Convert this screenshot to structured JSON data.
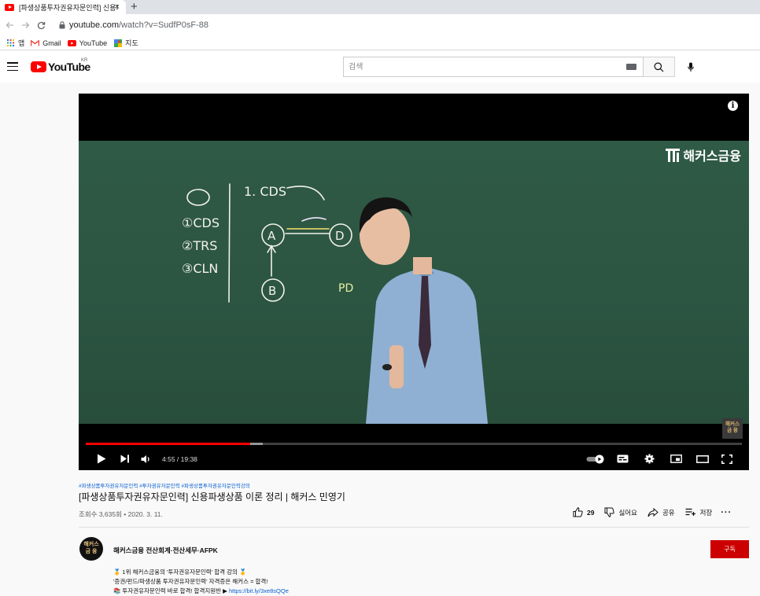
{
  "browser": {
    "tab_title": "[파생상품투자권유자문인력] 신용파생",
    "tab_close": "×",
    "new_tab": "+",
    "url_host": "youtube.com",
    "url_path": "/watch?v=SudfP0sF-88",
    "bookmarks": [
      {
        "label": "앱",
        "icon": "apps-grid-icon"
      },
      {
        "label": "Gmail",
        "icon": "gmail-icon"
      },
      {
        "label": "YouTube",
        "icon": "youtube-icon"
      },
      {
        "label": "지도",
        "icon": "maps-icon"
      }
    ]
  },
  "header": {
    "logo_text": "YouTube",
    "region": "KR",
    "search_placeholder": "검색"
  },
  "player": {
    "brand": "해커스금융",
    "watermark_line1": "해커스",
    "watermark_line2": "금 융",
    "current_time": "4:55",
    "duration": "19:38",
    "time_display": "4:55 / 19:38",
    "progress_played": 0.25,
    "progress_loaded": 0.27,
    "chalk_lines": [
      "1. CDS",
      "①CDS",
      "②TRS",
      "③CLN",
      "A",
      "B",
      "D",
      "PD"
    ]
  },
  "video": {
    "hashtags": "#파생상품투자권유자문인력 #투자권유자문인력 #파생상품투자권유자문인력강의",
    "title": "[파생상품투자권유자문인력] 신용파생상품 이론 정리 | 해커스 민영기",
    "meta": "조회수 3,635회 • 2020. 3. 11.",
    "likes": "29",
    "dislike_label": "싫어요",
    "share_label": "공유",
    "save_label": "저장",
    "more_label": "···"
  },
  "channel": {
    "avatar_line1": "해커스",
    "avatar_line2": "금 융",
    "name": "해커스금융 전산회계·전산세무·AFPK",
    "subscribe_label": "구독"
  },
  "description": {
    "line1": "🥇 1위 해커스금융의 '투자권유자문인력' 합격 강의 🥇",
    "line2": "'증권/펀드/파생상품 투자권유자문인력' 자격증은 해커스 = 합격!",
    "line3_text": "📚 투자권유자문인력 바로 합격! 합격지원반 ▶ ",
    "line3_link": "https://bit.ly/3xe8sQQe"
  }
}
